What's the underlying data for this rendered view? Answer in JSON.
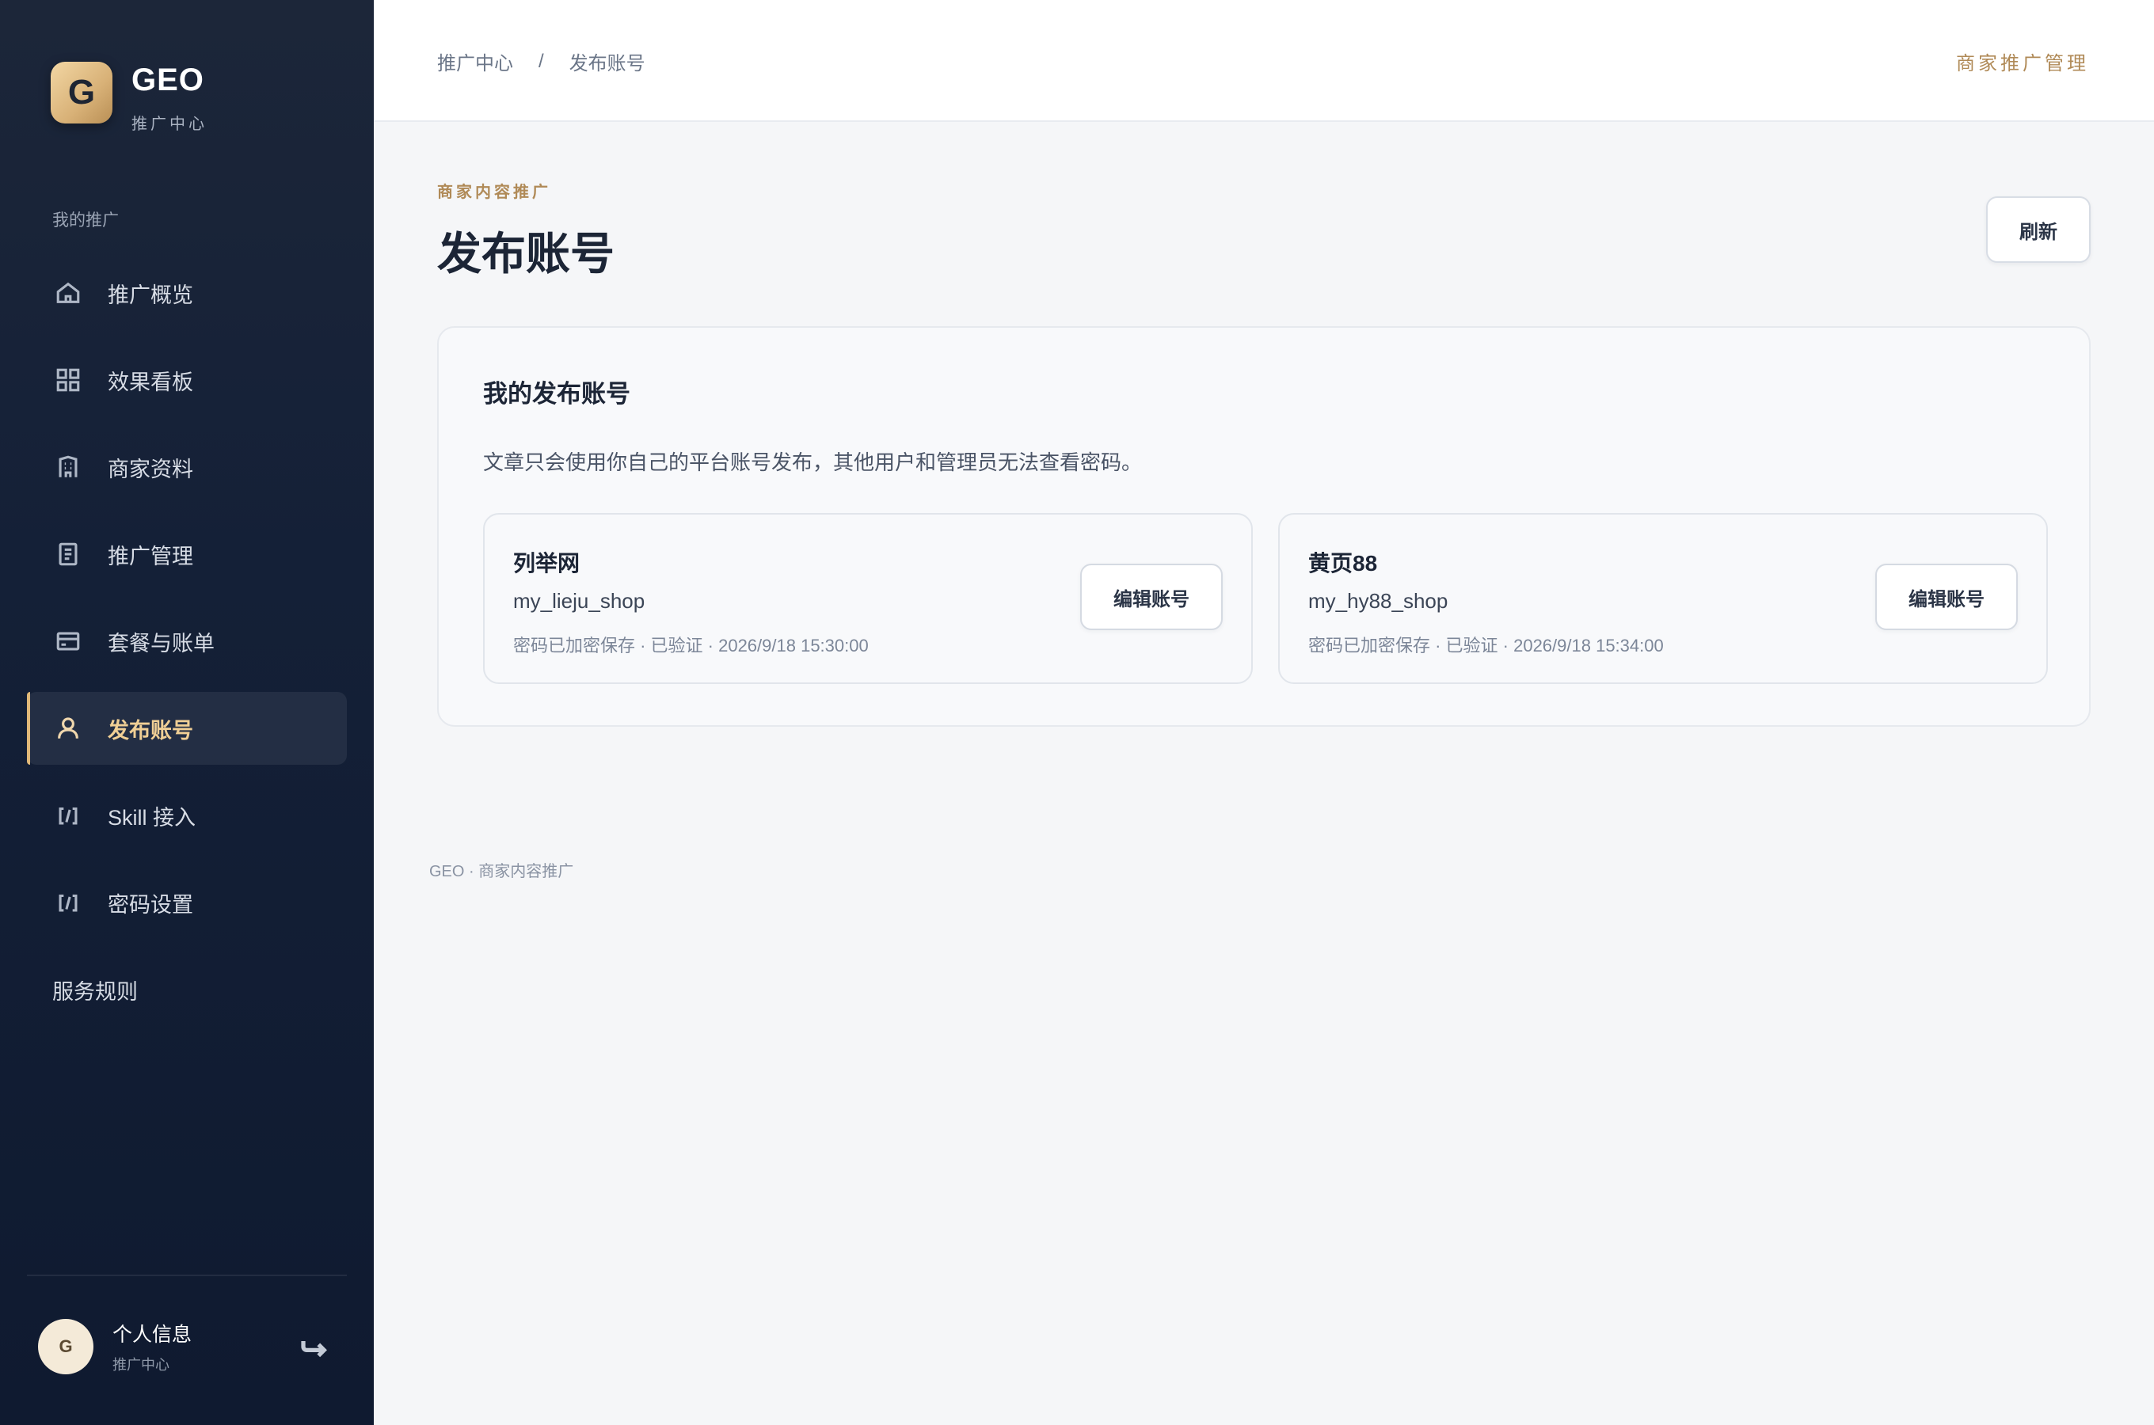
{
  "brand": {
    "logo_letter": "G",
    "name": "GEO",
    "subtitle": "推广中心"
  },
  "sidebar": {
    "section_label": "我的推广",
    "items": [
      {
        "label": "推广概览",
        "icon": "home-icon"
      },
      {
        "label": "效果看板",
        "icon": "grid-icon"
      },
      {
        "label": "商家资料",
        "icon": "building-icon"
      },
      {
        "label": "推广管理",
        "icon": "document-icon"
      },
      {
        "label": "套餐与账单",
        "icon": "card-icon"
      },
      {
        "label": "发布账号",
        "icon": "user-icon",
        "active": true
      },
      {
        "label": "Skill 接入",
        "icon": "code-icon"
      },
      {
        "label": "密码设置",
        "icon": "code-icon"
      },
      {
        "label": "服务规则"
      }
    ]
  },
  "profile": {
    "avatar_letter": "G",
    "name": "个人信息",
    "subtitle": "推广中心"
  },
  "header": {
    "breadcrumb": [
      "推广中心",
      "发布账号"
    ],
    "separator": "/",
    "right_label": "商家推广管理"
  },
  "main": {
    "eyebrow": "商家内容推广",
    "title": "发布账号",
    "refresh_label": "刷新",
    "panel": {
      "title": "我的发布账号",
      "description": "文章只会使用你自己的平台账号发布，其他用户和管理员无法查看密码。",
      "accounts": [
        {
          "platform": "列举网",
          "username": "my_lieju_shop",
          "meta": "密码已加密保存 · 已验证 · 2026/9/18 15:30:00",
          "edit_label": "编辑账号"
        },
        {
          "platform": "黄页88",
          "username": "my_hy88_shop",
          "meta": "密码已加密保存 · 已验证 · 2026/9/18 15:34:00",
          "edit_label": "编辑账号"
        }
      ]
    }
  },
  "footer": {
    "text": "GEO · 商家内容推广"
  },
  "colors": {
    "sidebar_bg": "#142037",
    "accent_gold": "#b08a57",
    "active_text": "#f0cf95",
    "page_bg": "#f5f6f8"
  }
}
